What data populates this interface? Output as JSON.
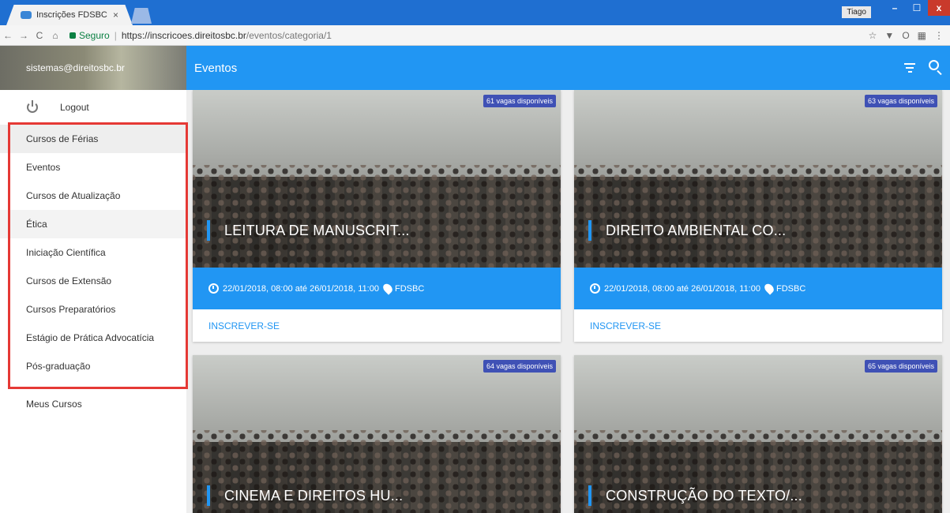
{
  "browser": {
    "tab_title": "Inscrições FDSBC",
    "tab_close": "×",
    "user_name": "Tiago",
    "secure_label": "Seguro",
    "url_main": "https://inscricoes.direitosbc.br",
    "url_path": "/eventos/categoria/1",
    "nav_back": "←",
    "nav_forward": "→",
    "reload": "C",
    "home": "⌂",
    "window_min": "–",
    "window_max": "☐",
    "window_close": "x"
  },
  "sidebar": {
    "user_email": "sistemas@direitosbc.br",
    "logout_label": "Logout",
    "items": [
      {
        "label": "Cursos de Férias"
      },
      {
        "label": "Eventos"
      },
      {
        "label": "Cursos de Atualização"
      },
      {
        "label": "Ética"
      },
      {
        "label": "Iniciação Científica"
      },
      {
        "label": "Cursos de Extensão"
      },
      {
        "label": "Cursos Preparatórios"
      },
      {
        "label": "Estágio de Prática Advocatícia"
      },
      {
        "label": "Pós-graduação"
      }
    ],
    "my_courses_label": "Meus Cursos"
  },
  "appbar": {
    "title": "Eventos"
  },
  "cards": [
    {
      "badge": "61 vagas disponíveis",
      "title": "LEITURA DE MANUSCRIT...",
      "date": "22/01/2018, 08:00 até 26/01/2018, 11:00",
      "location": "FDSBC",
      "action": "INSCREVER-SE"
    },
    {
      "badge": "63 vagas disponíveis",
      "title": "DIREITO AMBIENTAL CO...",
      "date": "22/01/2018, 08:00 até 26/01/2018, 11:00",
      "location": "FDSBC",
      "action": "INSCREVER-SE"
    },
    {
      "badge": "64 vagas disponíveis",
      "title": "CINEMA E DIREITOS HU...",
      "date": "",
      "location": "",
      "action": ""
    },
    {
      "badge": "65 vagas disponíveis",
      "title": "CONSTRUÇÃO DO TEXTO/...",
      "date": "",
      "location": "",
      "action": ""
    }
  ]
}
